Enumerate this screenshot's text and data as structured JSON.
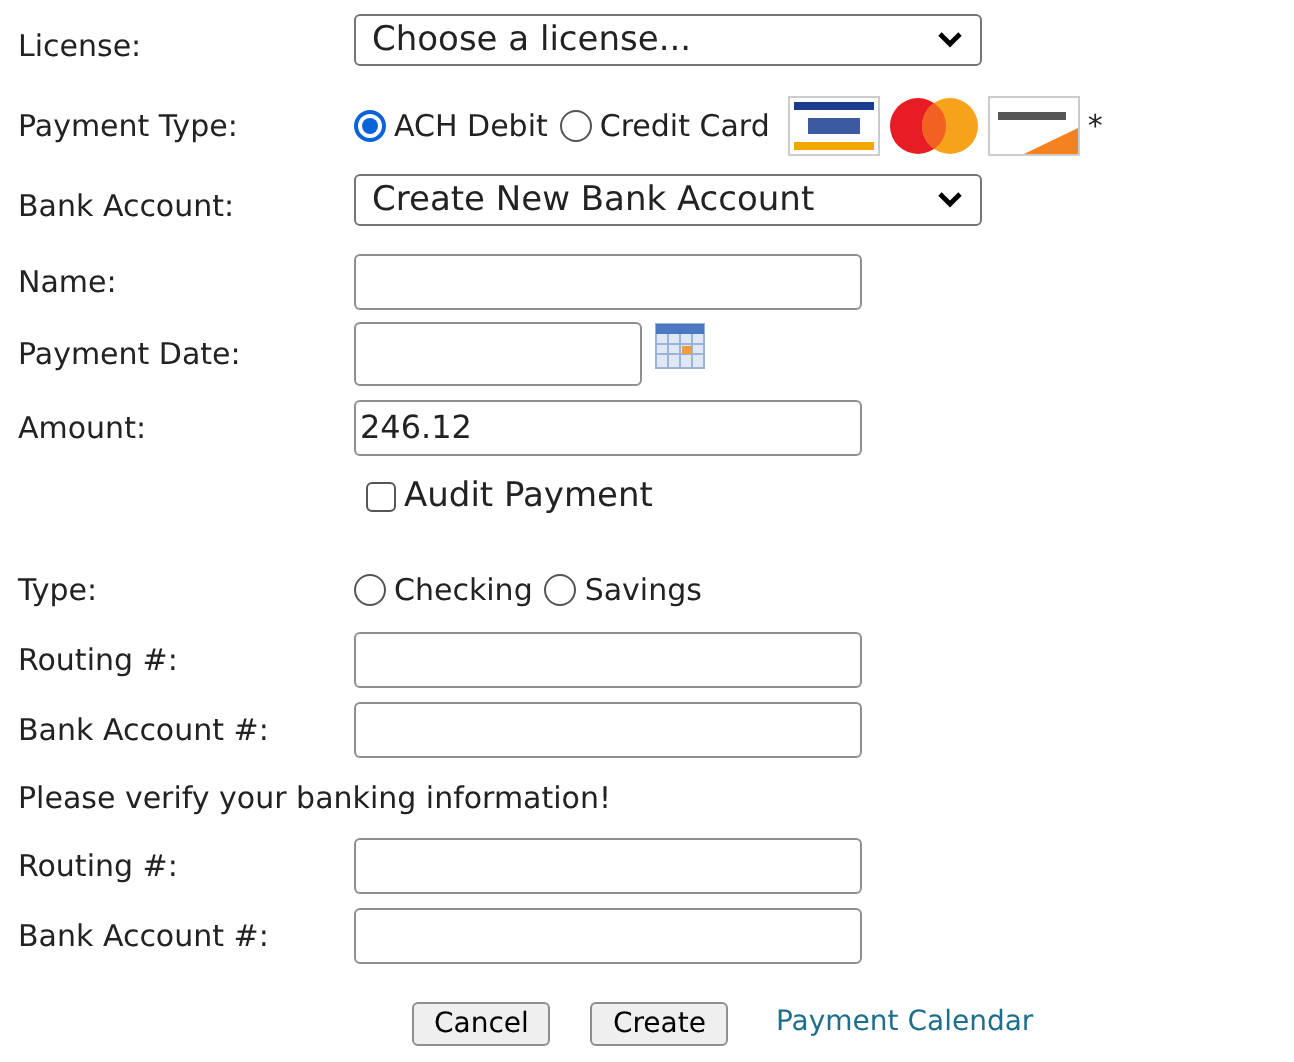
{
  "rows": [
    {
      "kind": "select",
      "label": "License:",
      "value": "Choose a license..."
    },
    {
      "kind": "radios",
      "label": "Payment Type:",
      "options": [
        {
          "label": "ACH Debit",
          "selected": true
        },
        {
          "label": "Credit Card",
          "selected": false
        }
      ],
      "card_logos": true,
      "note": "*"
    },
    {
      "kind": "select",
      "label": "Bank Account:",
      "value": "Create New Bank Account"
    },
    {
      "kind": "input",
      "label": "Name:"
    },
    {
      "kind": "date",
      "label": "Payment Date:"
    },
    {
      "kind": "input",
      "label": "Amount:",
      "value": "246.12"
    },
    {
      "kind": "checkbox",
      "label": "Audit Payment",
      "checked": false
    },
    {
      "kind": "radios",
      "label": "Type:",
      "options": [
        {
          "label": "Checking",
          "selected": false
        },
        {
          "label": "Savings",
          "selected": false
        }
      ]
    },
    {
      "kind": "input",
      "label": "Routing #:"
    },
    {
      "kind": "input",
      "label": "Bank Account #:"
    },
    {
      "kind": "message",
      "text": "Please verify your banking information!"
    },
    {
      "kind": "input",
      "label": "Routing #:"
    },
    {
      "kind": "input",
      "label": "Bank Account #:"
    }
  ],
  "buttons": [
    "Cancel",
    "Create"
  ],
  "link": "Payment Calendar"
}
